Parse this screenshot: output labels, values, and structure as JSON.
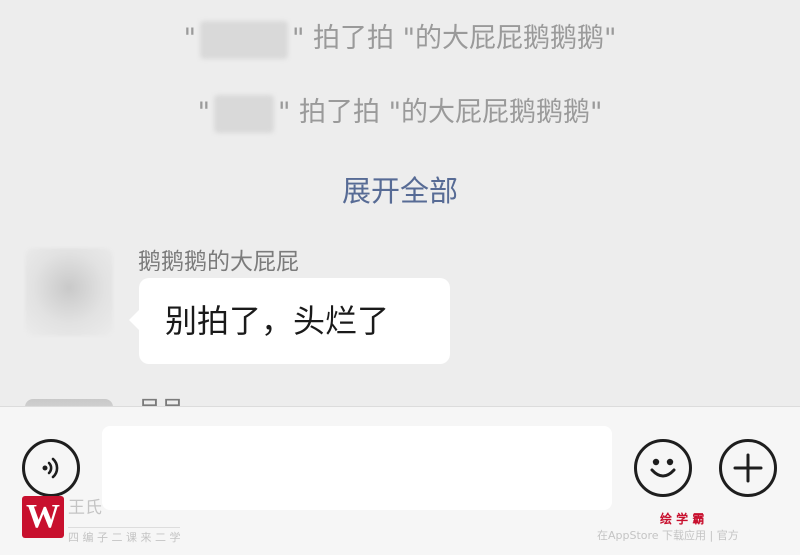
{
  "chat": {
    "system_messages": [
      {
        "prefix": "\"",
        "suffix": "\" 拍了拍 \"的大屁屁鹅鹅鹅\""
      },
      {
        "prefix": "\"",
        "suffix": "\" 拍了拍 \"的大屁屁鹅鹅鹅\""
      }
    ],
    "expand_label": "展开全部",
    "messages": [
      {
        "sender": "鹅鹅鹅的大屁屁",
        "text": "别拍了，头烂了"
      },
      {
        "sender": "吊吊"
      }
    ]
  },
  "input_bar": {
    "voice_icon": "voice-icon",
    "emoji_icon": "emoji-icon",
    "plus_icon": "plus-icon",
    "input_value": ""
  },
  "watermark": {
    "logo_letter": "W",
    "left_text": "王氏",
    "left_subtext": "四 编 子 二 课 来 二 学",
    "right_brand": "绘 学 霸",
    "right_text": "在AppStore 下载应用 | 官方"
  },
  "colors": {
    "background": "#ededed",
    "link": "#576b95",
    "bubble": "#ffffff",
    "brand_red": "#c8102e"
  }
}
